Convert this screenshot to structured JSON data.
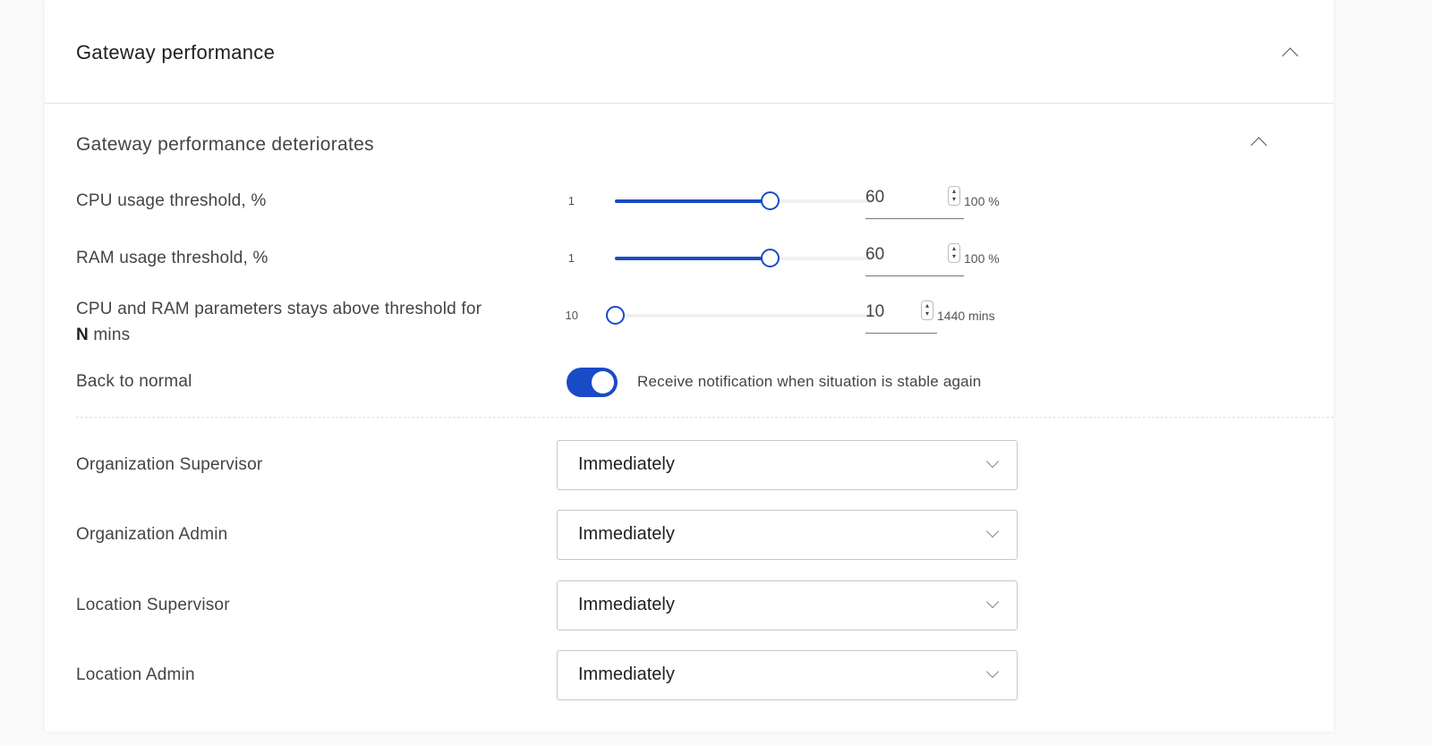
{
  "section": {
    "title": "Gateway performance"
  },
  "subsection": {
    "title": "Gateway performance deteriorates"
  },
  "rows": {
    "cpu": {
      "label": "CPU usage threshold, %",
      "min": "1",
      "value": "60",
      "max_unit": "100 %",
      "fraction": 0.6
    },
    "ram": {
      "label": "RAM usage threshold, %",
      "min": "1",
      "value": "60",
      "max_unit": "100 %",
      "fraction": 0.6
    },
    "duration": {
      "label_part1": "CPU and RAM parameters stays above threshold for",
      "label_bold": "N",
      "label_part2": "mins",
      "min": "10",
      "value": "10",
      "max_unit": "1440 mins",
      "fraction": 0.0
    },
    "back_to_normal": {
      "label": "Back to normal",
      "enabled": true,
      "description": "Receive notification when situation is stable again"
    }
  },
  "recipients": [
    {
      "label": "Organization Supervisor",
      "value": "Immediately"
    },
    {
      "label": "Organization Admin",
      "value": "Immediately"
    },
    {
      "label": "Location Supervisor",
      "value": "Immediately"
    },
    {
      "label": "Location Admin",
      "value": "Immediately"
    }
  ],
  "colors": {
    "accent": "#1a4bc6"
  }
}
